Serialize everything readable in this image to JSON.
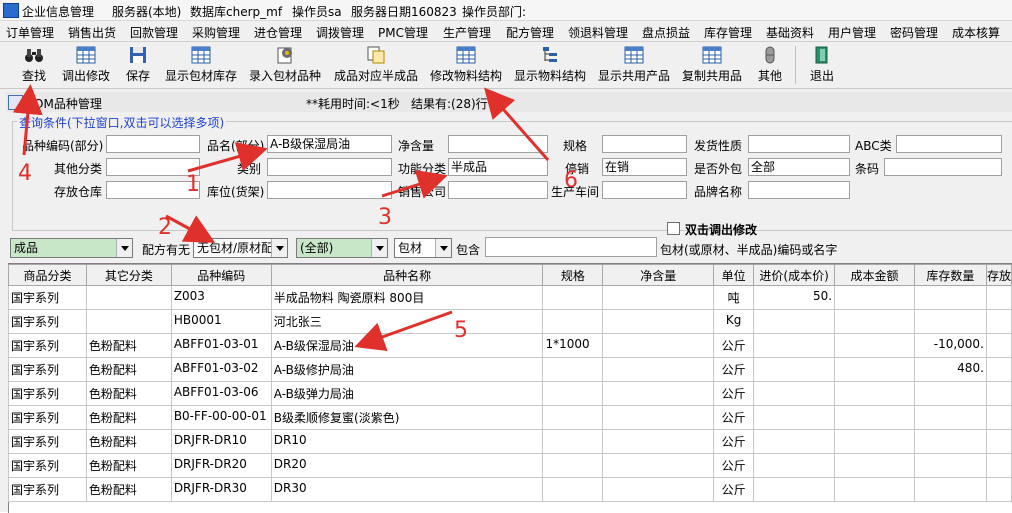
{
  "titlebar": {
    "module": "企业信息管理",
    "server": "服务器(本地)",
    "database": "数据库cherp_mf",
    "operator": "操作员sa",
    "server_date": "服务器日期160823",
    "dept": "操作员部门:"
  },
  "menu": [
    "订单管理",
    "销售出货",
    "回款管理",
    "采购管理",
    "进仓管理",
    "调拨管理",
    "PMC管理",
    "生产管理",
    "配方管理",
    "领退料管理",
    "盘点损益",
    "库存管理",
    "基础资料",
    "用户管理",
    "密码管理",
    "成本核算"
  ],
  "toolbar": [
    {
      "label": "查找",
      "icon": "binoculars-icon"
    },
    {
      "label": "调出修改",
      "icon": "grid-icon"
    },
    {
      "label": "保存",
      "icon": "floppy-disk-icon"
    },
    {
      "label": "显示包材库存",
      "icon": "grid-icon"
    },
    {
      "label": "录入包材品种",
      "icon": "gear-document-icon"
    },
    {
      "label": "成品对应半成品",
      "icon": "copy-document-icon"
    },
    {
      "label": "修改物料结构",
      "icon": "grid-icon"
    },
    {
      "label": "显示物料结构",
      "icon": "tree-icon"
    },
    {
      "label": "显示共用产品",
      "icon": "grid-icon"
    },
    {
      "label": "复制共用品",
      "icon": "grid-icon"
    },
    {
      "label": "其他",
      "icon": "capsule-icon"
    },
    {
      "label": "退出",
      "icon": "exit-door-icon"
    }
  ],
  "window": {
    "title": "BOM品种管理",
    "elapsed": "**耗用时间:<1秒",
    "result": "结果有:(28)行"
  },
  "query": {
    "group_title": "查询条件(下拉窗口,双击可以选择多项)",
    "labels": {
      "code": "品种编码(部分)",
      "name": "品名(部分)",
      "net": "净含量",
      "spec": "规格",
      "ship_type": "发货性质",
      "abc": "ABC类",
      "other_cat": "其他分类",
      "category": "类别",
      "function_cat": "功能分类",
      "sales": "停销",
      "outsourced": "是否外包",
      "barcode": "条码",
      "warehouse": "存放仓库",
      "location": "库位(货架)",
      "company": "销售公司",
      "workshop": "生产车间",
      "brand": "品牌名称"
    },
    "values": {
      "name": "A-B级保湿局油",
      "function_cat": "半成品",
      "sales": "在销",
      "outsourced": "全部"
    }
  },
  "filters": {
    "type": "成品",
    "formula_label": "配方有无",
    "material": "无包材/原材配",
    "all": "(全部)",
    "packaging": "包材",
    "contains_label": "包含",
    "contains_value": "",
    "hint": "包材(或原材、半成品)编码或名字",
    "dblclick_label": "双击调出修改"
  },
  "table": {
    "headers": [
      "商品分类",
      "其它分类",
      "品种编码",
      "品种名称",
      "规格",
      "净含量",
      "单位",
      "进价(成本价)",
      "成本金额",
      "库存数量",
      "存放"
    ],
    "rows": [
      [
        "国宇系列",
        "",
        "Z003",
        "半成品物料 陶瓷原料  800目",
        "",
        "",
        "吨",
        "50.",
        "",
        "",
        ""
      ],
      [
        "国宇系列",
        "",
        "HB0001",
        "河北张三",
        "",
        "",
        "Kg",
        "",
        "",
        "",
        ""
      ],
      [
        "国宇系列",
        "色粉配料",
        "ABFF01-03-01",
        "A-B级保湿局油",
        "1*1000",
        "",
        "公斤",
        "",
        "",
        "-10,000.",
        ""
      ],
      [
        "国宇系列",
        "色粉配料",
        "ABFF01-03-02",
        "A-B级修护局油",
        "",
        "",
        "公斤",
        "",
        "",
        "480.",
        ""
      ],
      [
        "国宇系列",
        "色粉配料",
        "ABFF01-03-06",
        "A-B级弹力局油",
        "",
        "",
        "公斤",
        "",
        "",
        "",
        ""
      ],
      [
        "国宇系列",
        "色粉配料",
        "B0-FF-00-00-01",
        "B级柔顺修复蜜(淡紫色)",
        "",
        "",
        "公斤",
        "",
        "",
        "",
        ""
      ],
      [
        "国宇系列",
        "色粉配料",
        "DRJFR-DR10",
        "DR10",
        "",
        "",
        "公斤",
        "",
        "",
        "",
        ""
      ],
      [
        "国宇系列",
        "色粉配料",
        "DRJFR-DR20",
        "DR20",
        "",
        "",
        "公斤",
        "",
        "",
        "",
        ""
      ],
      [
        "国宇系列",
        "色粉配料",
        "DRJFR-DR30",
        "DR30",
        "",
        "",
        "公斤",
        "",
        "",
        "",
        ""
      ]
    ]
  },
  "annotations": [
    "1",
    "2",
    "3",
    "4",
    "5",
    "6"
  ],
  "colors": {
    "annotation": "#e0302c",
    "group_title": "#1c3fd6",
    "combo_green": "#c8e6c8"
  }
}
